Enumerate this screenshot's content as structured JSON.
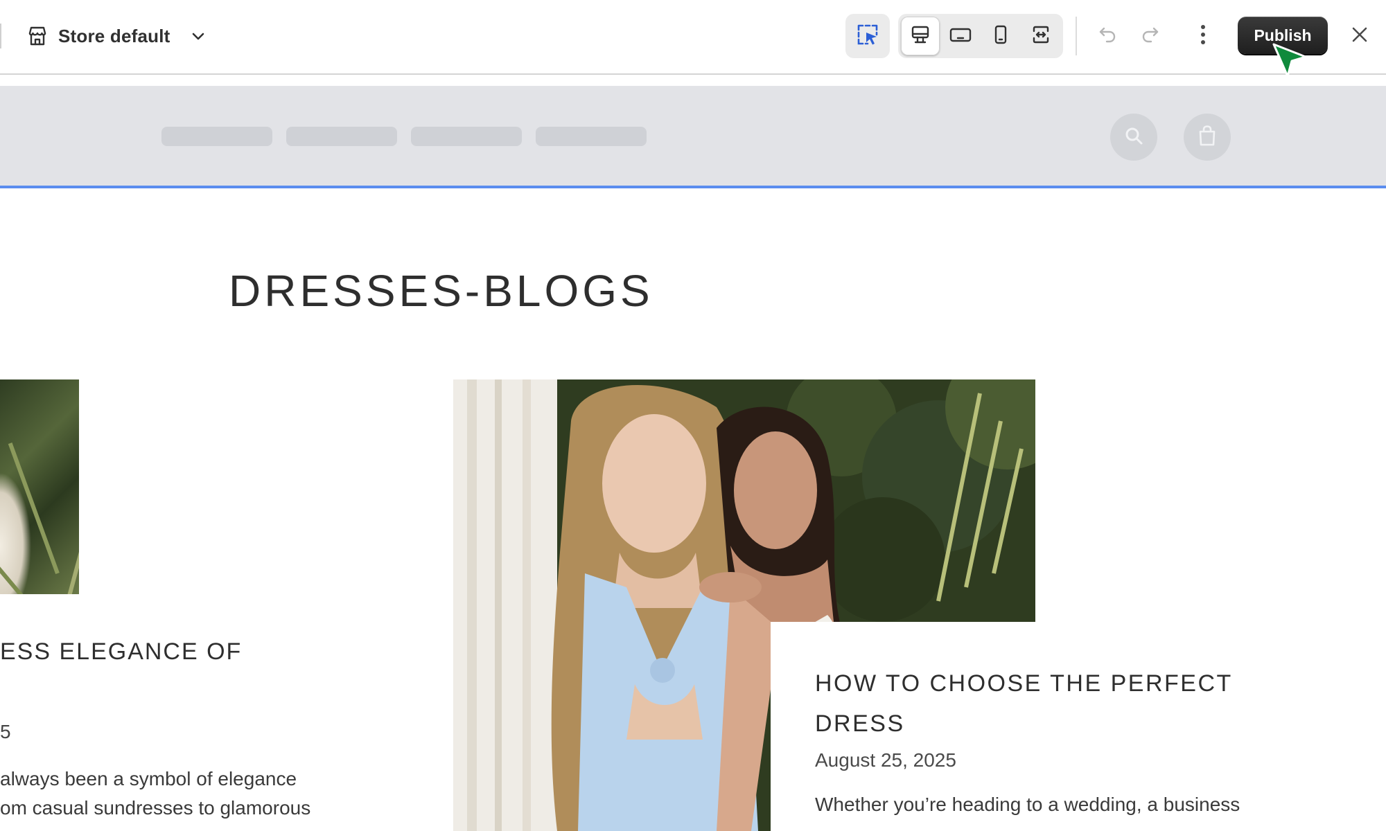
{
  "toolbar": {
    "store_selector_label": "Store default",
    "publish_label": "Publish",
    "icons": {
      "store": "store-icon",
      "chevron": "chevron-down-icon",
      "select_tool": "inspector-select-icon",
      "desktop": "desktop-icon",
      "tablet_landscape": "tablet-landscape-icon",
      "mobile": "mobile-icon",
      "full_width": "full-width-icon",
      "undo": "undo-icon",
      "redo": "redo-icon",
      "more": "more-vertical-icon",
      "close": "close-icon"
    },
    "active_viewport": "desktop"
  },
  "store_header": {
    "nav_placeholders": 4,
    "icons": [
      "search-icon",
      "shopping-bag-icon"
    ],
    "selection_outline_color": "#5b8def"
  },
  "page": {
    "title": "DRESSES-BLOGS"
  },
  "articles": [
    {
      "title_visible": "ESS ELEGANCE OF",
      "date_visible": "5",
      "excerpt_lines_visible": [
        "always been a symbol of elegance",
        "om casual sundresses to glamorous"
      ]
    },
    {
      "title": "HOW TO CHOOSE THE PERFECT DRESS",
      "date": "August 25, 2025",
      "excerpt_visible": "Whether you’re heading to a wedding, a business"
    }
  ],
  "colors": {
    "publish_bg": "#303030",
    "cursor": "#0f8a3c",
    "header_placeholder_bg": "#e2e3e7",
    "accent_selection": "#2c5fd6"
  }
}
